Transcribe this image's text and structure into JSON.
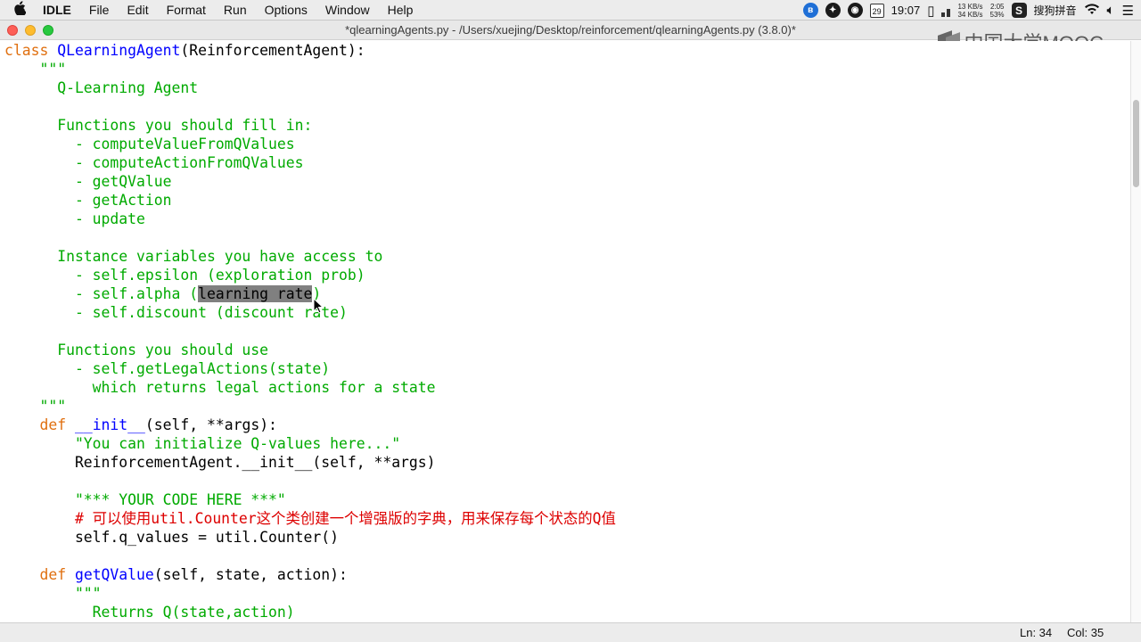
{
  "menubar": {
    "apple": "",
    "items": [
      "IDLE",
      "File",
      "Edit",
      "Format",
      "Run",
      "Options",
      "Window",
      "Help"
    ],
    "status": {
      "calendar_day": "29",
      "clock": "19:07",
      "net_up": "13 KB/s",
      "net_down": "34 KB/s",
      "battery_time": "2:05",
      "battery_pct": "53%",
      "ime": "搜狗拼音"
    }
  },
  "window": {
    "title": "*qlearningAgents.py - /Users/xuejing/Desktop/reinforcement/qlearningAgents.py (3.8.0)*"
  },
  "watermark": {
    "text": "中国大学MOOC"
  },
  "editor": {
    "lines": [
      [
        {
          "t": "class ",
          "c": "kw"
        },
        {
          "t": "QLearningAgent",
          "c": "def"
        },
        {
          "t": "(ReinforcementAgent):",
          "c": ""
        }
      ],
      [
        {
          "t": "    \"\"\"",
          "c": "str"
        }
      ],
      [
        {
          "t": "      Q-Learning Agent",
          "c": "str"
        }
      ],
      [
        {
          "t": "",
          "c": ""
        }
      ],
      [
        {
          "t": "      Functions you should fill in:",
          "c": "str"
        }
      ],
      [
        {
          "t": "        - computeValueFromQValues",
          "c": "str"
        }
      ],
      [
        {
          "t": "        - computeActionFromQValues",
          "c": "str"
        }
      ],
      [
        {
          "t": "        - getQValue",
          "c": "str"
        }
      ],
      [
        {
          "t": "        - getAction",
          "c": "str"
        }
      ],
      [
        {
          "t": "        - update",
          "c": "str"
        }
      ],
      [
        {
          "t": "",
          "c": ""
        }
      ],
      [
        {
          "t": "      Instance variables you have access to",
          "c": "str"
        }
      ],
      [
        {
          "t": "        - self.epsilon (exploration prob)",
          "c": "str"
        }
      ],
      [
        {
          "t": "        - self.alpha (",
          "c": "str"
        },
        {
          "t": "learning rate",
          "c": "sel"
        },
        {
          "t": ")",
          "c": "str"
        }
      ],
      [
        {
          "t": "        - self.discount (discount rate)",
          "c": "str"
        }
      ],
      [
        {
          "t": "",
          "c": ""
        }
      ],
      [
        {
          "t": "      Functions you should use",
          "c": "str"
        }
      ],
      [
        {
          "t": "        - self.getLegalActions(state)",
          "c": "str"
        }
      ],
      [
        {
          "t": "          which returns legal actions for a state",
          "c": "str"
        }
      ],
      [
        {
          "t": "    \"\"\"",
          "c": "str"
        }
      ],
      [
        {
          "t": "    def ",
          "c": "kw"
        },
        {
          "t": "__init__",
          "c": "def"
        },
        {
          "t": "(self, **args):",
          "c": ""
        }
      ],
      [
        {
          "t": "        \"You can initialize Q-values here...\"",
          "c": "str"
        }
      ],
      [
        {
          "t": "        ReinforcementAgent.__init__(self, **args)",
          "c": ""
        }
      ],
      [
        {
          "t": "",
          "c": ""
        }
      ],
      [
        {
          "t": "        \"*** YOUR CODE HERE ***\"",
          "c": "str"
        }
      ],
      [
        {
          "t": "        # 可以使用util.Counter这个类创建一个增强版的字典，用来保存每个状态的Q值",
          "c": "cmt"
        }
      ],
      [
        {
          "t": "        self.q_values = util.Counter()",
          "c": ""
        }
      ],
      [
        {
          "t": "",
          "c": ""
        }
      ],
      [
        {
          "t": "    def ",
          "c": "kw"
        },
        {
          "t": "getQValue",
          "c": "def"
        },
        {
          "t": "(self, state, action):",
          "c": ""
        }
      ],
      [
        {
          "t": "        \"\"\"",
          "c": "str"
        }
      ],
      [
        {
          "t": "          Returns Q(state,action)",
          "c": "str"
        }
      ]
    ]
  },
  "statusbar": {
    "ln": "Ln: 34",
    "col": "Col: 35"
  },
  "colors": {
    "keyword": "#e07010",
    "definition": "#0000ff",
    "string": "#00aa00",
    "comment": "#dd0000",
    "selection": "#808080"
  }
}
